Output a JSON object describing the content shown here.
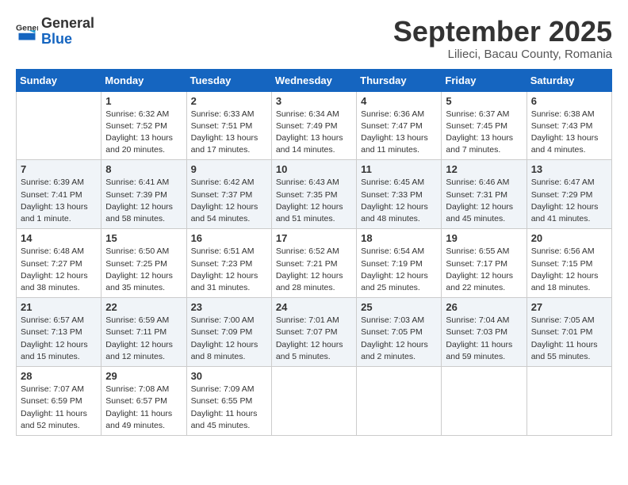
{
  "header": {
    "logo_general": "General",
    "logo_blue": "Blue",
    "month_title": "September 2025",
    "location": "Lilieci, Bacau County, Romania"
  },
  "days_of_week": [
    "Sunday",
    "Monday",
    "Tuesday",
    "Wednesday",
    "Thursday",
    "Friday",
    "Saturday"
  ],
  "weeks": [
    [
      {
        "day": "",
        "info": ""
      },
      {
        "day": "1",
        "info": "Sunrise: 6:32 AM\nSunset: 7:52 PM\nDaylight: 13 hours\nand 20 minutes."
      },
      {
        "day": "2",
        "info": "Sunrise: 6:33 AM\nSunset: 7:51 PM\nDaylight: 13 hours\nand 17 minutes."
      },
      {
        "day": "3",
        "info": "Sunrise: 6:34 AM\nSunset: 7:49 PM\nDaylight: 13 hours\nand 14 minutes."
      },
      {
        "day": "4",
        "info": "Sunrise: 6:36 AM\nSunset: 7:47 PM\nDaylight: 13 hours\nand 11 minutes."
      },
      {
        "day": "5",
        "info": "Sunrise: 6:37 AM\nSunset: 7:45 PM\nDaylight: 13 hours\nand 7 minutes."
      },
      {
        "day": "6",
        "info": "Sunrise: 6:38 AM\nSunset: 7:43 PM\nDaylight: 13 hours\nand 4 minutes."
      }
    ],
    [
      {
        "day": "7",
        "info": "Sunrise: 6:39 AM\nSunset: 7:41 PM\nDaylight: 13 hours\nand 1 minute."
      },
      {
        "day": "8",
        "info": "Sunrise: 6:41 AM\nSunset: 7:39 PM\nDaylight: 12 hours\nand 58 minutes."
      },
      {
        "day": "9",
        "info": "Sunrise: 6:42 AM\nSunset: 7:37 PM\nDaylight: 12 hours\nand 54 minutes."
      },
      {
        "day": "10",
        "info": "Sunrise: 6:43 AM\nSunset: 7:35 PM\nDaylight: 12 hours\nand 51 minutes."
      },
      {
        "day": "11",
        "info": "Sunrise: 6:45 AM\nSunset: 7:33 PM\nDaylight: 12 hours\nand 48 minutes."
      },
      {
        "day": "12",
        "info": "Sunrise: 6:46 AM\nSunset: 7:31 PM\nDaylight: 12 hours\nand 45 minutes."
      },
      {
        "day": "13",
        "info": "Sunrise: 6:47 AM\nSunset: 7:29 PM\nDaylight: 12 hours\nand 41 minutes."
      }
    ],
    [
      {
        "day": "14",
        "info": "Sunrise: 6:48 AM\nSunset: 7:27 PM\nDaylight: 12 hours\nand 38 minutes."
      },
      {
        "day": "15",
        "info": "Sunrise: 6:50 AM\nSunset: 7:25 PM\nDaylight: 12 hours\nand 35 minutes."
      },
      {
        "day": "16",
        "info": "Sunrise: 6:51 AM\nSunset: 7:23 PM\nDaylight: 12 hours\nand 31 minutes."
      },
      {
        "day": "17",
        "info": "Sunrise: 6:52 AM\nSunset: 7:21 PM\nDaylight: 12 hours\nand 28 minutes."
      },
      {
        "day": "18",
        "info": "Sunrise: 6:54 AM\nSunset: 7:19 PM\nDaylight: 12 hours\nand 25 minutes."
      },
      {
        "day": "19",
        "info": "Sunrise: 6:55 AM\nSunset: 7:17 PM\nDaylight: 12 hours\nand 22 minutes."
      },
      {
        "day": "20",
        "info": "Sunrise: 6:56 AM\nSunset: 7:15 PM\nDaylight: 12 hours\nand 18 minutes."
      }
    ],
    [
      {
        "day": "21",
        "info": "Sunrise: 6:57 AM\nSunset: 7:13 PM\nDaylight: 12 hours\nand 15 minutes."
      },
      {
        "day": "22",
        "info": "Sunrise: 6:59 AM\nSunset: 7:11 PM\nDaylight: 12 hours\nand 12 minutes."
      },
      {
        "day": "23",
        "info": "Sunrise: 7:00 AM\nSunset: 7:09 PM\nDaylight: 12 hours\nand 8 minutes."
      },
      {
        "day": "24",
        "info": "Sunrise: 7:01 AM\nSunset: 7:07 PM\nDaylight: 12 hours\nand 5 minutes."
      },
      {
        "day": "25",
        "info": "Sunrise: 7:03 AM\nSunset: 7:05 PM\nDaylight: 12 hours\nand 2 minutes."
      },
      {
        "day": "26",
        "info": "Sunrise: 7:04 AM\nSunset: 7:03 PM\nDaylight: 11 hours\nand 59 minutes."
      },
      {
        "day": "27",
        "info": "Sunrise: 7:05 AM\nSunset: 7:01 PM\nDaylight: 11 hours\nand 55 minutes."
      }
    ],
    [
      {
        "day": "28",
        "info": "Sunrise: 7:07 AM\nSunset: 6:59 PM\nDaylight: 11 hours\nand 52 minutes."
      },
      {
        "day": "29",
        "info": "Sunrise: 7:08 AM\nSunset: 6:57 PM\nDaylight: 11 hours\nand 49 minutes."
      },
      {
        "day": "30",
        "info": "Sunrise: 7:09 AM\nSunset: 6:55 PM\nDaylight: 11 hours\nand 45 minutes."
      },
      {
        "day": "",
        "info": ""
      },
      {
        "day": "",
        "info": ""
      },
      {
        "day": "",
        "info": ""
      },
      {
        "day": "",
        "info": ""
      }
    ]
  ]
}
